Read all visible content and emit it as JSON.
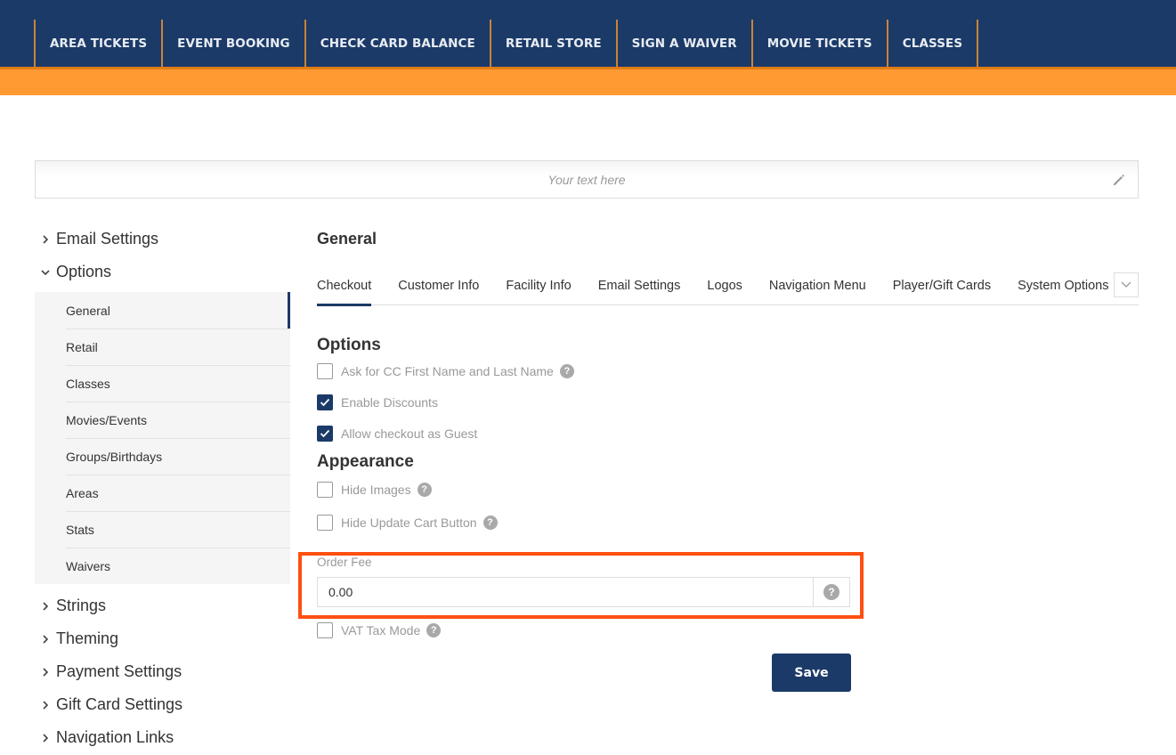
{
  "topnav": {
    "items": [
      "AREA TICKETS",
      "EVENT BOOKING",
      "CHECK CARD BALANCE",
      "RETAIL STORE",
      "SIGN A WAIVER",
      "MOVIE TICKETS",
      "CLASSES"
    ]
  },
  "banner": {
    "placeholder_text": "Your text here",
    "edit_icon": "pencil-icon"
  },
  "sidebar": {
    "groups_top": [
      {
        "label": "Email Settings",
        "expanded": false
      },
      {
        "label": "Options",
        "expanded": true
      }
    ],
    "options_items": [
      "General",
      "Retail",
      "Classes",
      "Movies/Events",
      "Groups/Birthdays",
      "Areas",
      "Stats",
      "Waivers"
    ],
    "options_active": "General",
    "groups_bottom": [
      "Strings",
      "Theming",
      "Payment Settings",
      "Gift Card Settings",
      "Navigation Links"
    ]
  },
  "main": {
    "title": "General",
    "tabs": [
      "Checkout",
      "Customer Info",
      "Facility Info",
      "Email Settings",
      "Logos",
      "Navigation Menu",
      "Player/Gift Cards",
      "System Options"
    ],
    "active_tab": "Checkout",
    "options_heading": "Options",
    "options": [
      {
        "label": "Ask for CC First Name and Last Name",
        "checked": false,
        "help": true
      },
      {
        "label": "Enable Discounts",
        "checked": true,
        "help": false
      },
      {
        "label": "Allow checkout as Guest",
        "checked": true,
        "help": false
      }
    ],
    "appearance_heading": "Appearance",
    "appearance": [
      {
        "label": "Hide Images",
        "checked": false,
        "help": true
      },
      {
        "label": "Hide Update Cart Button",
        "checked": false,
        "help": true
      }
    ],
    "order_fee": {
      "label": "Order Fee",
      "value": "0.00"
    },
    "vat": {
      "label": "VAT Tax Mode",
      "checked": false
    },
    "help_glyph": "?",
    "save_label": "Save"
  },
  "colors": {
    "navy": "#1b3a68",
    "orange": "#ff9a33",
    "highlight": "#ff4f12"
  }
}
